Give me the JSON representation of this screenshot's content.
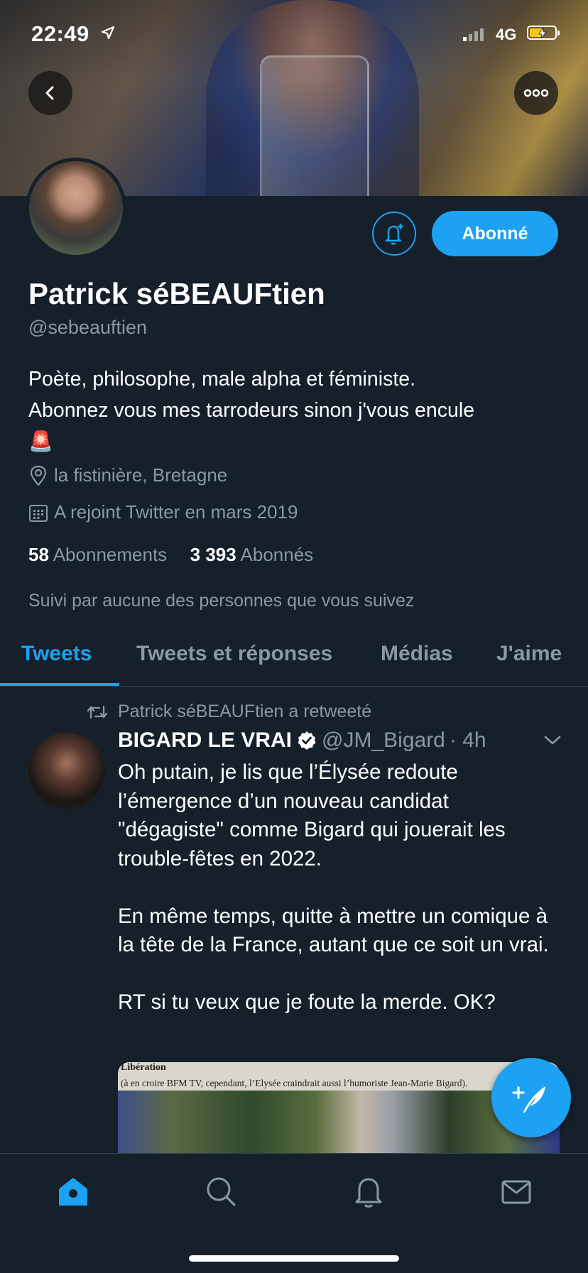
{
  "status_bar": {
    "time": "22:49",
    "network": "4G"
  },
  "profile": {
    "display_name": "Patrick séBEAUFtien",
    "handle": "@sebeauftien",
    "bio_line1": "Poète, philosophe, male alpha et féministe.",
    "bio_line2": "Abonnez vous mes tarrodeurs sinon j'vous encule",
    "bio_emoji": "🚨",
    "location": "la fistinière, Bretagne",
    "joined": "A rejoint Twitter en mars 2019",
    "following_count": "58",
    "following_label": "Abonnements",
    "followers_count": "3 393",
    "followers_label": "Abonnés",
    "followed_by": "Suivi par aucune des personnes que vous suivez",
    "follow_button": "Abonné"
  },
  "tabs": [
    {
      "label": "Tweets",
      "active": true
    },
    {
      "label": "Tweets et réponses",
      "active": false
    },
    {
      "label": "Médias",
      "active": false
    },
    {
      "label": "J'aime",
      "active": false
    }
  ],
  "tweet": {
    "retweet_label": "Patrick séBEAUFtien a retweeté",
    "author": "BIGARD LE VRAI",
    "verified": true,
    "handle": "@JM_Bigard",
    "time": "· 4h",
    "text": "Oh putain, je lis que l’Élysée redoute l’émergence d’un nouveau candidat \"dégagiste\" comme Bigard qui jouerait les trouble-fêtes en 2022.\n\nEn même temps, quitte à mettre un comique à la tête de la France, autant que ce soit un vrai.\n\nRT si tu veux que je foute la merde. OK?",
    "media_masthead": "Libération",
    "media_caption": "(à en croire BFM TV, cependant, l’Elysée craindrait aussi l’humoriste Jean-Marie Bigard)."
  },
  "colors": {
    "accent": "#1da1f2",
    "background": "#15202b",
    "muted": "#8899a6"
  },
  "icons": {
    "bottom_nav": [
      "home-icon",
      "search-icon",
      "notifications-icon",
      "messages-icon"
    ]
  }
}
